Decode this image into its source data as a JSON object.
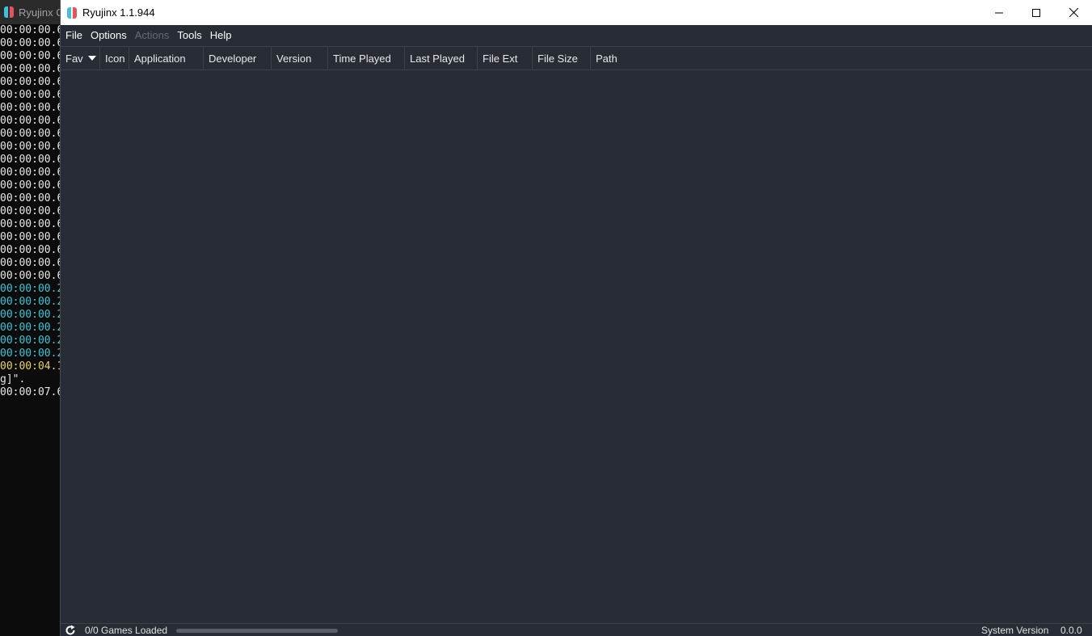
{
  "console": {
    "title": "Ryujinx C",
    "lines": [
      {
        "text": "00:00:00.6",
        "color": "#e6e6e6"
      },
      {
        "text": "00:00:00.6",
        "color": "#e6e6e6"
      },
      {
        "text": "00:00:00.6",
        "color": "#e6e6e6"
      },
      {
        "text": "00:00:00.6",
        "color": "#e6e6e6"
      },
      {
        "text": "00:00:00.6",
        "color": "#e6e6e6"
      },
      {
        "text": "00:00:00.6",
        "color": "#e6e6e6"
      },
      {
        "text": "00:00:00.6",
        "color": "#e6e6e6"
      },
      {
        "text": "00:00:00.6",
        "color": "#e6e6e6"
      },
      {
        "text": "00:00:00.6",
        "color": "#e6e6e6"
      },
      {
        "text": "00:00:00.6",
        "color": "#e6e6e6"
      },
      {
        "text": "00:00:00.6",
        "color": "#e6e6e6"
      },
      {
        "text": "00:00:00.6",
        "color": "#e6e6e6"
      },
      {
        "text": "00:00:00.6",
        "color": "#e6e6e6"
      },
      {
        "text": "00:00:00.6",
        "color": "#e6e6e6"
      },
      {
        "text": "00:00:00.6",
        "color": "#e6e6e6"
      },
      {
        "text": "00:00:00.6",
        "color": "#e6e6e6"
      },
      {
        "text": "00:00:00.6",
        "color": "#e6e6e6"
      },
      {
        "text": "00:00:00.6",
        "color": "#e6e6e6"
      },
      {
        "text": "00:00:00.6",
        "color": "#e6e6e6"
      },
      {
        "text": "00:00:00.6",
        "color": "#e6e6e6"
      },
      {
        "text": "00:00:00.2",
        "color": "#3ac6d6"
      },
      {
        "text": "00:00:00.2",
        "color": "#3ac6d6"
      },
      {
        "text": "00:00:00.2",
        "color": "#3ac6d6"
      },
      {
        "text": "00:00:00.2",
        "color": "#3ac6d6"
      },
      {
        "text": "00:00:00.2",
        "color": "#3ac6d6"
      },
      {
        "text": "00:00:00.2",
        "color": "#3ac6d6"
      },
      {
        "text": "00:00:04.1",
        "color": "#e8d36a"
      },
      {
        "text": "g]\".",
        "color": "#e6e6e6"
      },
      {
        "text": "00:00:07.6",
        "color": "#e6e6e6"
      }
    ]
  },
  "window": {
    "title": "Ryujinx 1.1.944"
  },
  "menu": {
    "items": [
      {
        "label": "File",
        "enabled": true
      },
      {
        "label": "Options",
        "enabled": true
      },
      {
        "label": "Actions",
        "enabled": false
      },
      {
        "label": "Tools",
        "enabled": true
      },
      {
        "label": "Help",
        "enabled": true
      }
    ]
  },
  "table": {
    "columns": [
      {
        "label": "Fav",
        "sorted": true
      },
      {
        "label": "Icon"
      },
      {
        "label": "Application"
      },
      {
        "label": "Developer"
      },
      {
        "label": "Version"
      },
      {
        "label": "Time Played"
      },
      {
        "label": "Last Played"
      },
      {
        "label": "File Ext"
      },
      {
        "label": "File Size"
      },
      {
        "label": "Path"
      }
    ],
    "rows": []
  },
  "status": {
    "games_loaded": "0/0 Games Loaded",
    "load_progress": 0,
    "system_version_label": "System Version",
    "system_version_value": "0.0.0"
  },
  "colors": {
    "window_bg": "#282c34",
    "logo_left": "#3fc1d8",
    "logo_right": "#e8505b"
  }
}
